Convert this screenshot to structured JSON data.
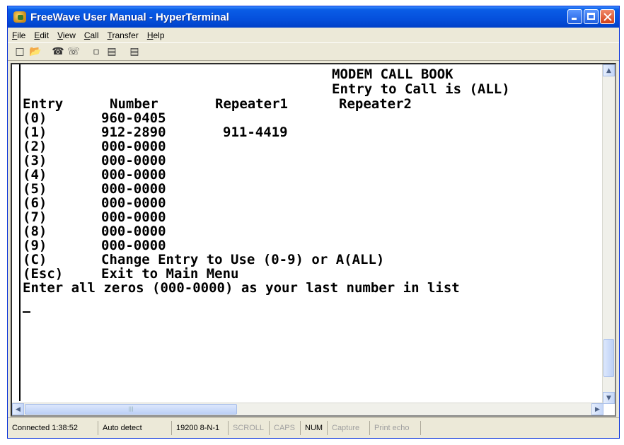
{
  "window": {
    "title": "FreeWave User Manual - HyperTerminal"
  },
  "menu": [
    "File",
    "Edit",
    "View",
    "Call",
    "Transfer",
    "Help"
  ],
  "toolbar_icons": [
    "new-icon",
    "open-icon",
    "disconnect-icon",
    "dial-icon",
    "send-icon",
    "receive-icon",
    "properties-icon"
  ],
  "terminal": {
    "title": "MODEM CALL BOOK",
    "subtitle": "Entry to Call is (ALL)",
    "headers": {
      "entry": "Entry",
      "number": "Number",
      "repeater1": "Repeater1",
      "repeater2": "Repeater2"
    },
    "rows": [
      {
        "entry": "(0)",
        "number": "960-0405",
        "repeater1": ""
      },
      {
        "entry": "(1)",
        "number": "912-2890",
        "repeater1": "911-4419"
      },
      {
        "entry": "(2)",
        "number": "000-0000",
        "repeater1": ""
      },
      {
        "entry": "(3)",
        "number": "000-0000",
        "repeater1": ""
      },
      {
        "entry": "(4)",
        "number": "000-0000",
        "repeater1": ""
      },
      {
        "entry": "(5)",
        "number": "000-0000",
        "repeater1": ""
      },
      {
        "entry": "(6)",
        "number": "000-0000",
        "repeater1": ""
      },
      {
        "entry": "(7)",
        "number": "000-0000",
        "repeater1": ""
      },
      {
        "entry": "(8)",
        "number": "000-0000",
        "repeater1": ""
      },
      {
        "entry": "(9)",
        "number": "000-0000",
        "repeater1": ""
      }
    ],
    "option_c": {
      "key": "(C)",
      "text": "Change Entry to Use (0-9) or A(ALL)"
    },
    "option_esc": {
      "key": "(Esc)",
      "text": "Exit to Main Menu"
    },
    "footer": "Enter all zeros (000-0000) as your last number in list"
  },
  "status": {
    "connected": "Connected 1:38:52",
    "detect": "Auto detect",
    "port": "19200 8-N-1",
    "scroll": "SCROLL",
    "caps": "CAPS",
    "num": "NUM",
    "capture": "Capture",
    "print_echo": "Print echo"
  }
}
